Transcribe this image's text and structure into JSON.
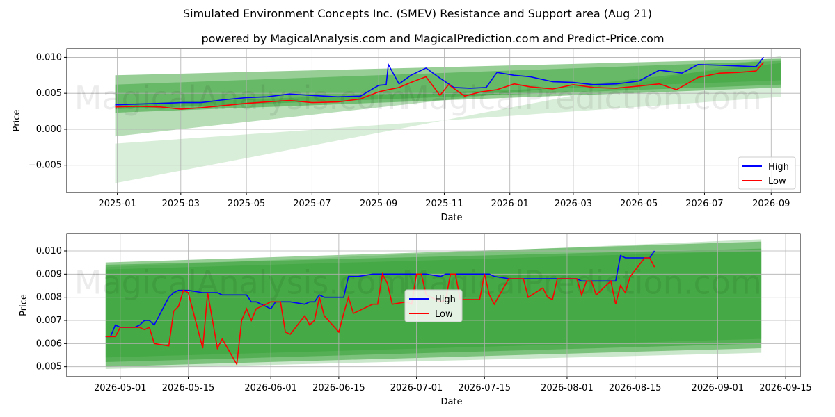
{
  "header": {
    "title": "Simulated Environment Concepts Inc. (SMEV) Resistance and Support area (Aug 21)",
    "subtitle": "powered by MagicalAnalysis.com and MagicalPrediction.com and Predict-Price.com"
  },
  "watermarks": [
    "MagicalAnalysis.com",
    "MagicalPrediction.com"
  ],
  "colors": {
    "high": "#0000ff",
    "low": "#ff0000",
    "band": "#2e9e2e",
    "grid": "#b0b0b0"
  },
  "chart_data": [
    {
      "type": "line",
      "xlabel": "Date",
      "ylabel": "Price",
      "x_ticks": [
        "2025-01",
        "2025-03",
        "2025-05",
        "2025-07",
        "2025-09",
        "2025-11",
        "2026-01",
        "2026-03",
        "2026-05",
        "2026-07",
        "2026-09"
      ],
      "y_ticks": [
        "0.010",
        "0.005",
        "0.000",
        "−0.005"
      ],
      "ylim": [
        -0.0088,
        0.0112
      ],
      "grid": true,
      "legend": {
        "position": "lower-right",
        "entries": [
          "High",
          "Low"
        ]
      },
      "series": [
        {
          "name": "High",
          "x": [
            "2024-12-30",
            "2025-01-20",
            "2025-02-10",
            "2025-03-01",
            "2025-03-20",
            "2025-04-10",
            "2025-05-01",
            "2025-05-20",
            "2025-06-10",
            "2025-07-01",
            "2025-07-25",
            "2025-08-15",
            "2025-09-01",
            "2025-09-08",
            "2025-09-10",
            "2025-09-20",
            "2025-10-01",
            "2025-10-15",
            "2025-10-28",
            "2025-11-10",
            "2025-11-25",
            "2025-12-10",
            "2025-12-20",
            "2026-01-05",
            "2026-01-20",
            "2026-02-10",
            "2026-03-01",
            "2026-03-20",
            "2026-04-10",
            "2026-05-01",
            "2026-05-20",
            "2026-06-10",
            "2026-06-25",
            "2026-07-15",
            "2026-08-01",
            "2026-08-18",
            "2026-08-25"
          ],
          "values": [
            0.0034,
            0.0035,
            0.0036,
            0.0037,
            0.0037,
            0.0041,
            0.0044,
            0.0045,
            0.0049,
            0.0047,
            0.0045,
            0.0046,
            0.0061,
            0.0062,
            0.009,
            0.0063,
            0.0075,
            0.0085,
            0.0071,
            0.0058,
            0.0057,
            0.0058,
            0.0079,
            0.0075,
            0.0073,
            0.0066,
            0.0065,
            0.0062,
            0.0063,
            0.0067,
            0.0082,
            0.0078,
            0.009,
            0.0089,
            0.0088,
            0.0087,
            0.01
          ]
        },
        {
          "name": "Low",
          "x": [
            "2024-12-30",
            "2025-01-20",
            "2025-02-10",
            "2025-03-01",
            "2025-03-20",
            "2025-04-10",
            "2025-05-01",
            "2025-05-20",
            "2025-06-10",
            "2025-07-01",
            "2025-07-25",
            "2025-08-15",
            "2025-09-01",
            "2025-09-10",
            "2025-09-20",
            "2025-10-01",
            "2025-10-15",
            "2025-10-28",
            "2025-11-05",
            "2025-11-20",
            "2025-12-05",
            "2025-12-20",
            "2026-01-05",
            "2026-01-20",
            "2026-02-10",
            "2026-03-01",
            "2026-03-20",
            "2026-04-10",
            "2026-05-01",
            "2026-05-20",
            "2026-06-05",
            "2026-06-25",
            "2026-07-15",
            "2026-08-01",
            "2026-08-18",
            "2026-08-25"
          ],
          "values": [
            0.0031,
            0.0032,
            0.0031,
            0.0028,
            0.003,
            0.0033,
            0.0036,
            0.0038,
            0.004,
            0.0037,
            0.0038,
            0.0042,
            0.0052,
            0.0055,
            0.0058,
            0.0065,
            0.0073,
            0.0047,
            0.0062,
            0.0046,
            0.0052,
            0.0055,
            0.0063,
            0.0059,
            0.0056,
            0.0062,
            0.0058,
            0.0057,
            0.006,
            0.0063,
            0.0055,
            0.0072,
            0.0078,
            0.0079,
            0.0081,
            0.0093
          ]
        }
      ]
    },
    {
      "type": "line",
      "xlabel": "Date",
      "ylabel": "Price",
      "x_ticks": [
        "2026-05-01",
        "2026-05-15",
        "2026-06-01",
        "2026-06-15",
        "2026-07-01",
        "2026-07-15",
        "2026-08-01",
        "2026-08-15",
        "2026-09-01",
        "2026-09-15"
      ],
      "y_ticks": [
        "0.010",
        "0.009",
        "0.008",
        "0.007",
        "0.006",
        "0.005"
      ],
      "ylim": [
        0.00457,
        0.01075
      ],
      "grid": true,
      "legend": {
        "position": "center",
        "entries": [
          "High",
          "Low"
        ]
      },
      "series": [
        {
          "name": "High",
          "x": [
            "2026-04-28",
            "2026-04-29",
            "2026-04-30",
            "2026-05-01",
            "2026-05-04",
            "2026-05-05",
            "2026-05-06",
            "2026-05-07",
            "2026-05-08",
            "2026-05-11",
            "2026-05-12",
            "2026-05-13",
            "2026-05-14",
            "2026-05-15",
            "2026-05-18",
            "2026-05-19",
            "2026-05-20",
            "2026-05-21",
            "2026-05-22",
            "2026-05-25",
            "2026-05-26",
            "2026-05-27",
            "2026-05-28",
            "2026-05-29",
            "2026-06-01",
            "2026-06-02",
            "2026-06-03",
            "2026-06-04",
            "2026-06-05",
            "2026-06-08",
            "2026-06-09",
            "2026-06-10",
            "2026-06-11",
            "2026-06-12",
            "2026-06-15",
            "2026-06-16",
            "2026-06-17",
            "2026-06-18",
            "2026-06-19",
            "2026-06-22",
            "2026-06-23",
            "2026-06-24",
            "2026-06-25",
            "2026-06-26",
            "2026-06-29",
            "2026-06-30",
            "2026-07-01",
            "2026-07-02",
            "2026-07-03",
            "2026-07-06",
            "2026-07-07",
            "2026-07-08",
            "2026-07-09",
            "2026-07-10",
            "2026-07-13",
            "2026-07-14",
            "2026-07-15",
            "2026-07-16",
            "2026-07-17",
            "2026-07-20",
            "2026-07-21",
            "2026-07-22",
            "2026-07-23",
            "2026-07-24",
            "2026-07-27",
            "2026-07-28",
            "2026-07-29",
            "2026-07-30",
            "2026-07-31",
            "2026-08-03",
            "2026-08-04",
            "2026-08-05",
            "2026-08-06",
            "2026-08-07",
            "2026-08-10",
            "2026-08-11",
            "2026-08-12",
            "2026-08-13",
            "2026-08-14",
            "2026-08-17",
            "2026-08-18",
            "2026-08-19"
          ],
          "values": [
            0.0063,
            0.0063,
            0.0068,
            0.0067,
            0.0067,
            0.0068,
            0.007,
            0.007,
            0.0068,
            0.008,
            0.0082,
            0.0083,
            0.0083,
            0.0083,
            0.0082,
            0.0082,
            0.0082,
            0.0082,
            0.0081,
            0.0081,
            0.0081,
            0.0081,
            0.0078,
            0.0078,
            0.0075,
            0.0078,
            0.0078,
            0.0078,
            0.0078,
            0.0077,
            0.0078,
            0.0078,
            0.0081,
            0.008,
            0.008,
            0.008,
            0.0089,
            0.0089,
            0.0089,
            0.009,
            0.009,
            0.009,
            0.009,
            0.009,
            0.009,
            0.009,
            0.009,
            0.009,
            0.009,
            0.0089,
            0.009,
            0.009,
            0.009,
            0.009,
            0.009,
            0.009,
            0.009,
            0.009,
            0.0089,
            0.0088,
            0.0088,
            0.0088,
            0.0088,
            0.0088,
            0.0088,
            0.0088,
            0.0088,
            0.0088,
            0.0088,
            0.0088,
            0.0087,
            0.0087,
            0.0087,
            0.0087,
            0.0087,
            0.0087,
            0.0098,
            0.0097,
            0.0097,
            0.0097,
            0.0097,
            0.01
          ]
        },
        {
          "name": "Low",
          "x": [
            "2026-04-28",
            "2026-04-29",
            "2026-04-30",
            "2026-05-01",
            "2026-05-04",
            "2026-05-05",
            "2026-05-06",
            "2026-05-07",
            "2026-05-08",
            "2026-05-11",
            "2026-05-12",
            "2026-05-13",
            "2026-05-14",
            "2026-05-15",
            "2026-05-18",
            "2026-05-19",
            "2026-05-20",
            "2026-05-21",
            "2026-05-22",
            "2026-05-25",
            "2026-05-26",
            "2026-05-27",
            "2026-05-28",
            "2026-05-29",
            "2026-06-01",
            "2026-06-02",
            "2026-06-03",
            "2026-06-04",
            "2026-06-05",
            "2026-06-08",
            "2026-06-09",
            "2026-06-10",
            "2026-06-11",
            "2026-06-12",
            "2026-06-15",
            "2026-06-16",
            "2026-06-17",
            "2026-06-18",
            "2026-06-19",
            "2026-06-22",
            "2026-06-23",
            "2026-06-24",
            "2026-06-25",
            "2026-06-26",
            "2026-06-29",
            "2026-06-30",
            "2026-07-01",
            "2026-07-02",
            "2026-07-03",
            "2026-07-06",
            "2026-07-07",
            "2026-07-08",
            "2026-07-09",
            "2026-07-10",
            "2026-07-13",
            "2026-07-14",
            "2026-07-15",
            "2026-07-16",
            "2026-07-17",
            "2026-07-20",
            "2026-07-21",
            "2026-07-22",
            "2026-07-23",
            "2026-07-24",
            "2026-07-27",
            "2026-07-28",
            "2026-07-29",
            "2026-07-30",
            "2026-07-31",
            "2026-08-03",
            "2026-08-04",
            "2026-08-05",
            "2026-08-06",
            "2026-08-07",
            "2026-08-10",
            "2026-08-11",
            "2026-08-12",
            "2026-08-13",
            "2026-08-14",
            "2026-08-17",
            "2026-08-18",
            "2026-08-19"
          ],
          "values": [
            0.0063,
            0.0063,
            0.0063,
            0.0067,
            0.0067,
            0.0067,
            0.0066,
            0.0067,
            0.006,
            0.0059,
            0.0074,
            0.0076,
            0.0083,
            0.0082,
            0.0058,
            0.0082,
            0.007,
            0.0058,
            0.0062,
            0.0051,
            0.007,
            0.0075,
            0.007,
            0.0075,
            0.0078,
            0.0078,
            0.0078,
            0.0065,
            0.0064,
            0.0072,
            0.0068,
            0.007,
            0.008,
            0.0072,
            0.0065,
            0.0073,
            0.008,
            0.0073,
            0.0074,
            0.0077,
            0.0077,
            0.009,
            0.0086,
            0.0077,
            0.0078,
            0.0077,
            0.009,
            0.009,
            0.0081,
            0.0078,
            0.0079,
            0.009,
            0.009,
            0.0079,
            0.0079,
            0.0079,
            0.009,
            0.0081,
            0.0077,
            0.0088,
            0.0088,
            0.0088,
            0.0088,
            0.008,
            0.0084,
            0.008,
            0.0079,
            0.0088,
            0.0088,
            0.0088,
            0.0081,
            0.0087,
            0.0087,
            0.0081,
            0.0087,
            0.0077,
            0.0085,
            0.0082,
            0.0089,
            0.0097,
            0.0097,
            0.0093
          ]
        }
      ]
    }
  ]
}
